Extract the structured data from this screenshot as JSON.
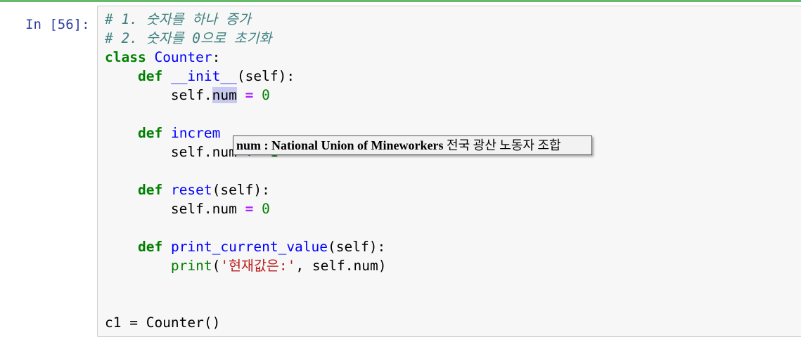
{
  "cell": {
    "prompt": "In [56]:",
    "lines": {
      "comment1": "# 1. 숫자를 하나 증가",
      "comment2": "# 2. 숫자를 0으로 초기화",
      "class_kw": "class",
      "class_name": "Counter",
      "colon": ":",
      "def_kw": "def",
      "init_name": "__init__",
      "self_param": "(self):",
      "self_dot": "self.",
      "num_attr": "num",
      "assign": "=",
      "zero": "0",
      "increment_visible": "increm",
      "incr_self_num": "self.num",
      "plus_eq": "+=",
      "one": "1",
      "reset_name": "reset",
      "print_name": "print_current_value",
      "print_fn": "print",
      "print_open": "(",
      "print_str": "'현재값은:'",
      "print_rest": ", self.num)",
      "self_num_full": "self.num",
      "last_line": "c1 = Counter()"
    }
  },
  "tooltip": {
    "term": "num",
    "separator": " : ",
    "definition": "National Union of Mineworkers",
    "translation": " 전국 광산 노동자 조합"
  },
  "colors": {
    "prompt": "#303f9f",
    "keyword": "#008000",
    "name": "#0000ff",
    "comment": "#408080",
    "operator": "#aa22ff",
    "string": "#ba2121",
    "cell_border_active": "#66bb6a"
  }
}
